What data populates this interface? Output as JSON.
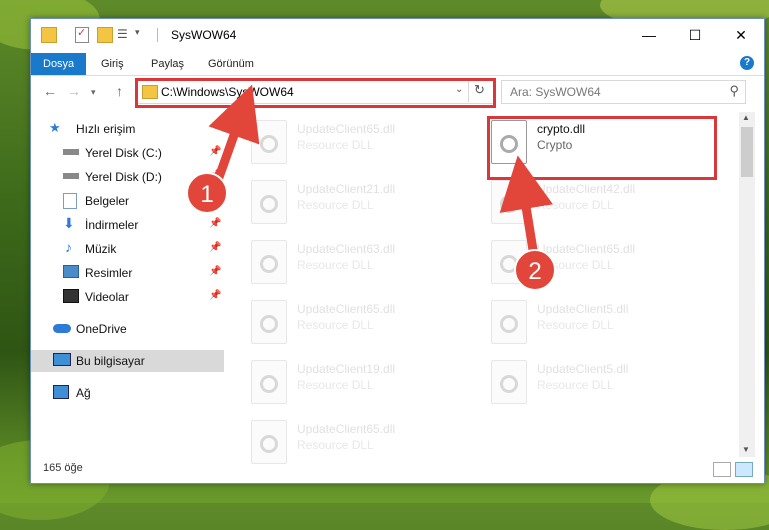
{
  "window": {
    "title": "SysWOW64",
    "controls": {
      "minimize": "—",
      "maximize": "☐",
      "close": "✕"
    }
  },
  "ribbon": {
    "tabs": [
      "Dosya",
      "Giriş",
      "Paylaş",
      "Görünüm"
    ],
    "help": "?"
  },
  "address": {
    "path": "C:\\Windows\\SysWOW64",
    "search_placeholder": "Ara: SysWOW64"
  },
  "sidebar": {
    "items": [
      {
        "label": "Hızlı erişim",
        "icon": "star-icon",
        "pinned": false
      },
      {
        "label": "Yerel Disk (C:)",
        "icon": "drive-icon",
        "pinned": true
      },
      {
        "label": "Yerel Disk (D:)",
        "icon": "drive-icon",
        "pinned": true
      },
      {
        "label": "Belgeler",
        "icon": "documents-icon",
        "pinned": true
      },
      {
        "label": "İndirmeler",
        "icon": "download-icon",
        "pinned": true
      },
      {
        "label": "Müzik",
        "icon": "music-icon",
        "pinned": true
      },
      {
        "label": "Resimler",
        "icon": "pictures-icon",
        "pinned": true
      },
      {
        "label": "Videolar",
        "icon": "videos-icon",
        "pinned": true
      },
      {
        "label": "OneDrive",
        "icon": "cloud-icon",
        "pinned": false
      },
      {
        "label": "Bu bilgisayar",
        "icon": "computer-icon",
        "pinned": false
      },
      {
        "label": "Ağ",
        "icon": "network-icon",
        "pinned": false
      }
    ]
  },
  "files": {
    "left": [
      {
        "name": "UpdateClient65.dll",
        "type": "Resource DLL"
      },
      {
        "name": "UpdateClient21.dll",
        "type": "Resource DLL"
      },
      {
        "name": "UpdateClient63.dll",
        "type": "Resource DLL"
      },
      {
        "name": "UpdateClient65.dll",
        "type": "Resource DLL"
      },
      {
        "name": "UpdateClient19.dll",
        "type": "Resource DLL"
      },
      {
        "name": "UpdateClient65.dll",
        "type": "Resource DLL"
      }
    ],
    "right": [
      {
        "name": "crypto.dll",
        "type": "Crypto"
      },
      {
        "name": "UpdateClient42.dll",
        "type": "Resource DLL"
      },
      {
        "name": "UpdateClient65.dll",
        "type": "Resource DLL"
      },
      {
        "name": "UpdateClient5.dll",
        "type": "Resource DLL"
      },
      {
        "name": "UpdateClient5.dll",
        "type": "Resource DLL"
      }
    ]
  },
  "status": {
    "count": "165 öğe"
  },
  "annotations": {
    "step1": "1",
    "step2": "2",
    "color": "#e2463b"
  }
}
